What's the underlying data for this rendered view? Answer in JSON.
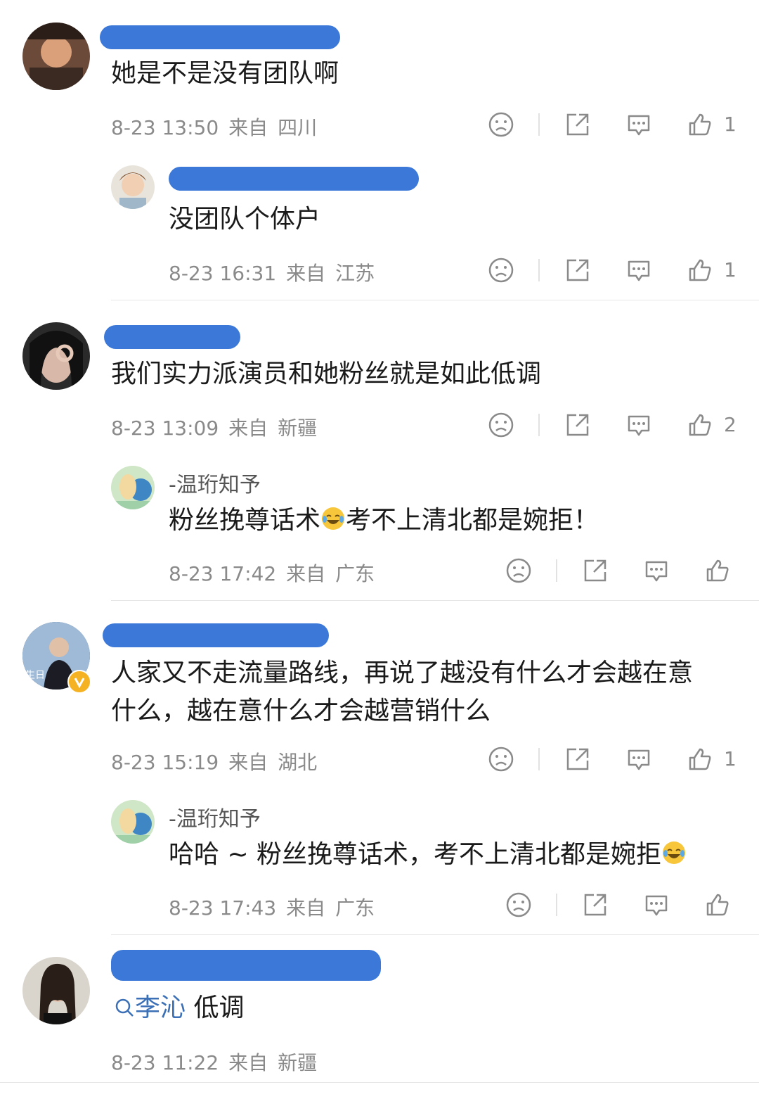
{
  "colors": {
    "redact": "#3b78d8",
    "text": "#1a1a1a",
    "meta": "#8a8a8a",
    "link": "#3b6fb6"
  },
  "comments": [
    {
      "text": "她是不是没有团队啊",
      "date": "8-23 13:50",
      "from": "来自",
      "location": "四川",
      "likes": "1",
      "reply": {
        "text": "没团队个体户",
        "date": "8-23 16:31",
        "from": "来自",
        "location": "江苏",
        "likes": "1"
      }
    },
    {
      "text": "我们实力派演员和她粉丝就是如此低调",
      "date": "8-23 13:09",
      "from": "来自",
      "location": "新疆",
      "likes": "2",
      "reply": {
        "name": "-温珩知予",
        "text_a": "粉丝挽尊话术",
        "text_b": "考不上清北都是婉拒！",
        "date": "8-23 17:42",
        "from": "来自",
        "location": "广东"
      }
    },
    {
      "text_line1": "人家又不走流量路线，再说了越没有什么才会越在意",
      "text_line2": "什么，越在意什么才会越营销什么",
      "date": "8-23 15:19",
      "from": "来自",
      "location": "湖北",
      "likes": "1",
      "reply": {
        "name": "-温珩知予",
        "text_a": "哈哈 ~ 粉丝挽尊话术，考不上清北都是婉拒",
        "date": "8-23 17:43",
        "from": "来自",
        "location": "广东"
      }
    },
    {
      "tag": "李沁",
      "text": "低调",
      "date": "8-23 11:22",
      "from": "来自",
      "location": "新疆"
    }
  ],
  "icons": [
    "sad-face-icon",
    "share-icon",
    "comment-icon",
    "thumbs-up-icon",
    "search-icon",
    "laughing-crying-emoji"
  ]
}
